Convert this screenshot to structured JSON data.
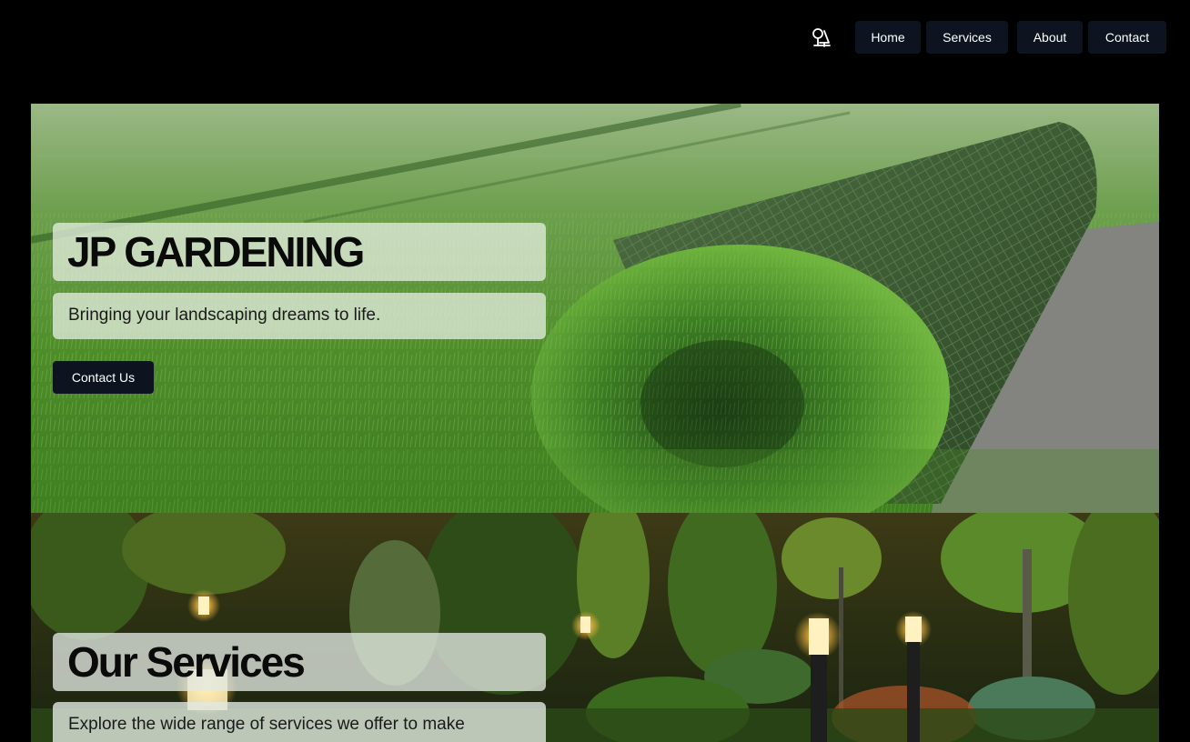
{
  "nav": {
    "logo_icon": "plant-icon",
    "items": [
      {
        "label": "Home"
      },
      {
        "label": "Services"
      },
      {
        "label": "About"
      },
      {
        "label": "Contact"
      }
    ]
  },
  "hero": {
    "title": "JP GARDENING",
    "subtitle": "Bringing your landscaping dreams to life.",
    "cta_label": "Contact Us",
    "image": "rolled-turf-photo"
  },
  "services": {
    "title": "Our Services",
    "subtitle": "Explore the wide range of services we offer to make",
    "image": "lit-garden-night-photo"
  },
  "colors": {
    "background": "#000000",
    "button_bg": "#0d1420",
    "button_text": "#ffffff",
    "panel_overlay": "rgba(225,236,220,0.78)"
  }
}
